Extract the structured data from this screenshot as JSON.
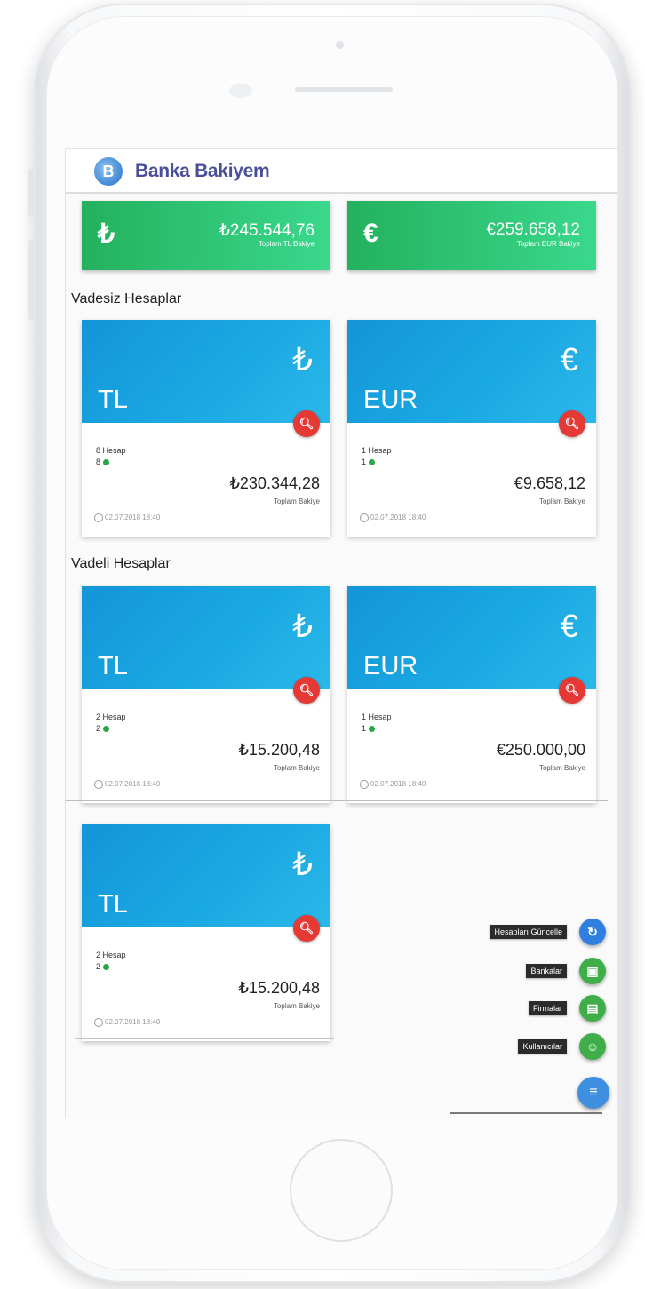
{
  "app": {
    "title": "Banka Bakiyem",
    "logo_letter": "B"
  },
  "totals": [
    {
      "symbol": "₺",
      "amount": "₺245.544,76",
      "label": "Toplam TL Bakiye"
    },
    {
      "symbol": "€",
      "amount": "€259.658,12",
      "label": "Toplam EUR Bakiye"
    }
  ],
  "sections": {
    "vadesiz": "Vadesiz Hesaplar",
    "vadeli": "Vadeli Hesaplar"
  },
  "cards": [
    {
      "symbol": "₺",
      "name": "TL",
      "count": "8 Hesap",
      "active": "8",
      "balance": "₺230.344,28",
      "balance_label": "Toplam Bakiye",
      "time": "02.07.2018 18:40"
    },
    {
      "symbol": "€",
      "name": "EUR",
      "count": "1 Hesap",
      "active": "1",
      "balance": "€9.658,12",
      "balance_label": "Toplam Bakiye",
      "time": "02.07.2018 18:40"
    },
    {
      "symbol": "₺",
      "name": "TL",
      "count": "2 Hesap",
      "active": "2",
      "balance": "₺15.200,48",
      "balance_label": "Toplam Bakiye",
      "time": "02.07.2018 18:40"
    },
    {
      "symbol": "€",
      "name": "EUR",
      "count": "1 Hesap",
      "active": "1",
      "balance": "€250.000,00",
      "balance_label": "Toplam Bakiye",
      "time": "02.07.2018 18:40"
    },
    {
      "symbol": "₺",
      "name": "TL",
      "count": "2 Hesap",
      "active": "2",
      "balance": "₺15.200,48",
      "balance_label": "Toplam Bakiye",
      "time": "02.07.2018 18:40"
    }
  ],
  "fab": {
    "actions": [
      {
        "label": "Hesapları Güncelle",
        "icon": "refresh-icon",
        "glyph": "↻",
        "color": "#2f7fe0"
      },
      {
        "label": "Bankalar",
        "icon": "bank-icon",
        "glyph": "▣",
        "color": "#3fae49"
      },
      {
        "label": "Firmalar",
        "icon": "store-icon",
        "glyph": "▤",
        "color": "#3fae49"
      },
      {
        "label": "Kullanıcılar",
        "icon": "users-icon",
        "glyph": "☺",
        "color": "#3fae49"
      }
    ],
    "main_glyph": "≡",
    "main_color": "#3f8fe0"
  }
}
